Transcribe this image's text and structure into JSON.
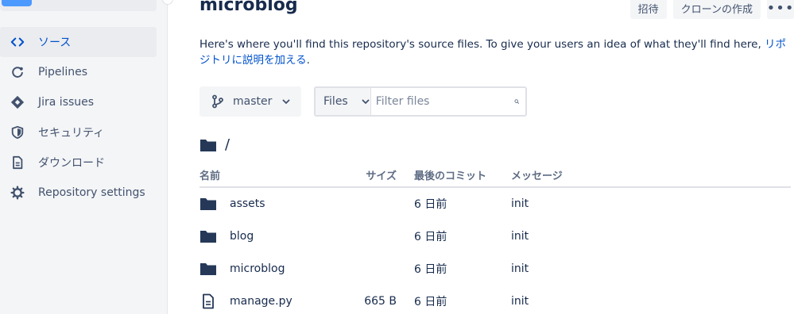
{
  "repo": {
    "title": "microblog",
    "invite_label": "招待",
    "clone_label": "クローンの作成",
    "more_label": "•••"
  },
  "sidebar": {
    "items": [
      {
        "label": "ソース",
        "icon": "code-icon",
        "active": true
      },
      {
        "label": "Pipelines",
        "icon": "pipelines-icon"
      },
      {
        "label": "Jira issues",
        "icon": "jira-icon"
      },
      {
        "label": "セキュリティ",
        "icon": "shield-icon"
      },
      {
        "label": "ダウンロード",
        "icon": "document-icon"
      },
      {
        "label": "Repository settings",
        "icon": "gear-icon"
      }
    ]
  },
  "description": {
    "text": "Here's where you'll find this repository's source files. To give your users an idea of what they'll find here, ",
    "link": "リポジトリに説明を加える",
    "suffix": "."
  },
  "toolbar": {
    "branch": "master",
    "files_select": "Files",
    "filter_placeholder": "Filter files"
  },
  "path": "/",
  "table": {
    "headers": {
      "name": "名前",
      "size": "サイズ",
      "commit": "最後のコミット",
      "message": "メッセージ"
    },
    "rows": [
      {
        "type": "folder",
        "name": "assets",
        "size": "",
        "commit": "6 日前",
        "message": "init"
      },
      {
        "type": "folder",
        "name": "blog",
        "size": "",
        "commit": "6 日前",
        "message": "init"
      },
      {
        "type": "folder",
        "name": "microblog",
        "size": "",
        "commit": "6 日前",
        "message": "init"
      },
      {
        "type": "file",
        "name": "manage.py",
        "size": "665 B",
        "commit": "6 日前",
        "message": "init"
      }
    ]
  },
  "colors": {
    "accent": "#0052cc",
    "sidebar_bg": "#f4f5f7",
    "text": "#172b4d"
  }
}
